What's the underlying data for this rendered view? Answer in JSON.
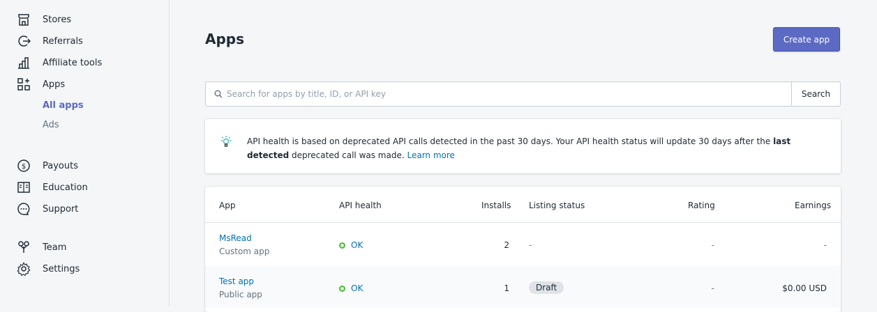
{
  "sidebar": {
    "items": [
      {
        "label": "Stores",
        "icon": "store-icon"
      },
      {
        "label": "Referrals",
        "icon": "referrals-icon"
      },
      {
        "label": "Affiliate tools",
        "icon": "affiliate-tools-icon"
      },
      {
        "label": "Apps",
        "icon": "apps-icon"
      },
      {
        "label": "Payouts",
        "icon": "payouts-icon"
      },
      {
        "label": "Education",
        "icon": "education-icon"
      },
      {
        "label": "Support",
        "icon": "support-icon"
      },
      {
        "label": "Team",
        "icon": "team-icon"
      },
      {
        "label": "Settings",
        "icon": "settings-icon"
      }
    ],
    "sub_items": [
      {
        "label": "All apps",
        "active": true
      },
      {
        "label": "Ads",
        "active": false
      }
    ]
  },
  "page": {
    "title": "Apps",
    "create_button": "Create app"
  },
  "search": {
    "placeholder": "Search for apps by title, ID, or API key",
    "button": "Search"
  },
  "banner": {
    "text_before": "API health is based on deprecated API calls detected in the past 30 days. Your API health status will update 30 days after the ",
    "bold_text": "last detected",
    "text_after": " deprecated call was made. ",
    "link": "Learn more"
  },
  "table": {
    "headers": {
      "app": "App",
      "api_health": "API health",
      "installs": "Installs",
      "listing_status": "Listing status",
      "rating": "Rating",
      "earnings": "Earnings"
    },
    "rows": [
      {
        "name": "MsRead",
        "type": "Custom app",
        "health": "OK",
        "installs": "2",
        "listing": "-",
        "rating": "-",
        "earnings": "-"
      },
      {
        "name": "Test app",
        "type": "Public app",
        "health": "OK",
        "installs": "1",
        "listing": "Draft",
        "rating": "-",
        "earnings": "$0.00 USD"
      }
    ]
  },
  "colors": {
    "accent": "#5c6ac4",
    "link": "#006fbb",
    "ok": "#50b83c"
  }
}
